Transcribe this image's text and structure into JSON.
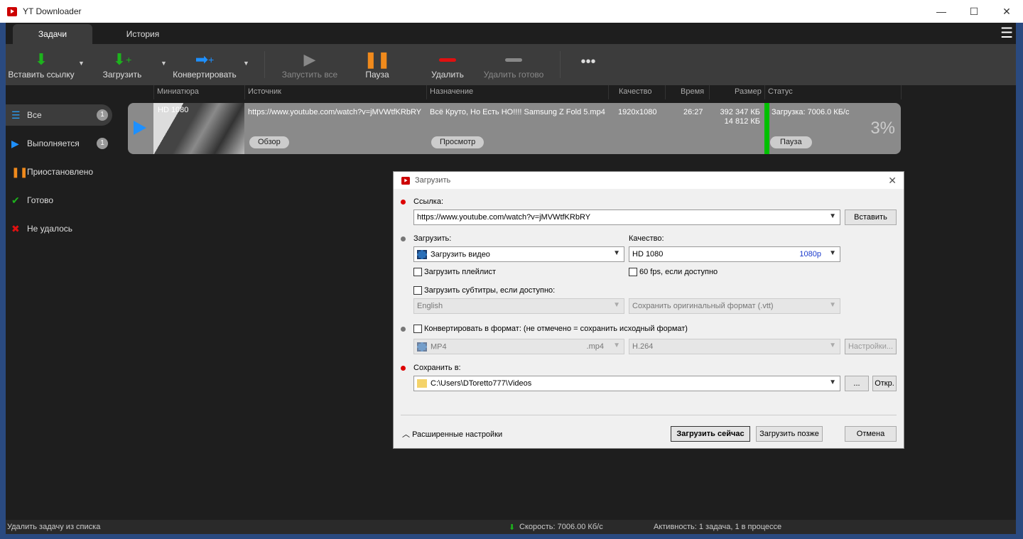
{
  "window": {
    "title": "YT Downloader"
  },
  "tabs": [
    "Задачи",
    "История"
  ],
  "toolbar": {
    "paste": "Вставить ссылку",
    "download": "Загрузить",
    "convert": "Конвертировать",
    "start_all": "Запустить все",
    "pause": "Пауза",
    "delete": "Удалить",
    "delete_done": "Удалить готово",
    "more": "•••"
  },
  "columns": {
    "thumb": "Миниатюра",
    "source": "Источник",
    "dest": "Назначение",
    "quality": "Качество",
    "time": "Время",
    "size": "Размер",
    "status": "Статус"
  },
  "sidebar": [
    {
      "label": "Все",
      "count": "1"
    },
    {
      "label": "Выполняется",
      "count": "1"
    },
    {
      "label": "Приостановлено"
    },
    {
      "label": "Готово"
    },
    {
      "label": "Не удалось"
    }
  ],
  "task": {
    "badge": "HD 1080",
    "source": "https://www.youtube.com/watch?v=jMVWtfKRbRY",
    "dest": "Всё Круто, Но Есть НО!!!! Samsung Z Fold 5.mp4",
    "quality": "1920x1080",
    "time": "26:27",
    "size_total": "392 347 КБ",
    "size_done": "14 812 КБ",
    "status": "Загрузка: 7006.0 КБ/с",
    "percent": "3%",
    "progress": 3,
    "browse": "Обзор",
    "view": "Просмотр",
    "pause": "Пауза"
  },
  "statusbar": {
    "hint": "Удалить задачу из списка",
    "speed": "Скорость: 7006.00 Кб/с",
    "activity": "Активность: 1 задача, 1 в процессе"
  },
  "dialog": {
    "title": "Загрузить",
    "link_label": "Ссылка:",
    "link": "https://www.youtube.com/watch?v=jMVWtfKRbRY",
    "paste": "Вставить",
    "download_label": "Загрузить:",
    "download_mode": "Загрузить видео",
    "quality_label": "Качество:",
    "quality": "HD 1080",
    "quality_tag": "1080p",
    "playlist": "Загрузить плейлист",
    "fps60": "60 fps, если доступно",
    "subs": "Загрузить субтитры, если доступно:",
    "subs_lang": "English",
    "subs_format": "Сохранить оригинальный формат (.vtt)",
    "convert": "Конвертировать в формат: (не отмечено = сохранить исходный формат)",
    "conv_format": "MP4",
    "conv_ext": ".mp4",
    "codec": "H.264",
    "conv_settings": "Настройки...",
    "save_label": "Сохранить в:",
    "save_path": "C:\\Users\\DToretto777\\Videos",
    "browse": "...",
    "open": "Откр.",
    "advanced": "Расширенные настройки",
    "download_now": "Загрузить сейчас",
    "download_later": "Загрузить позже",
    "cancel": "Отмена"
  }
}
